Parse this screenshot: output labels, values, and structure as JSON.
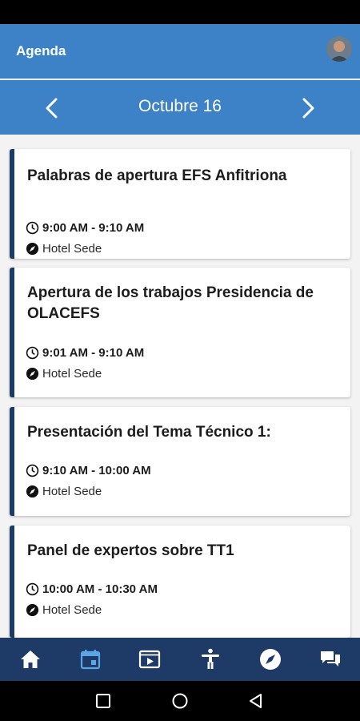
{
  "app_bar": {
    "title": "Agenda",
    "avatar_icon": "user-avatar"
  },
  "date_nav": {
    "date": "Octubre 16",
    "prev_icon": "chevron-left-icon",
    "next_icon": "chevron-right-icon"
  },
  "sessions": [
    {
      "title": "Palabras de apertura EFS Anfitriona",
      "time": "9:00 AM - 9:10 AM",
      "location": "Hotel Sede"
    },
    {
      "title": "Apertura de los trabajos Presidencia de OLACEFS",
      "time": "9:01 AM - 9:10 AM",
      "location": "Hotel Sede"
    },
    {
      "title": "Presentación del Tema Técnico 1:",
      "time": "9:10 AM - 10:00 AM",
      "location": "Hotel Sede"
    },
    {
      "title": "Panel de expertos sobre TT1",
      "time": "10:00 AM - 10:30 AM",
      "location": "Hotel Sede"
    }
  ],
  "bottom_nav": {
    "items": [
      "home-icon",
      "calendar-icon",
      "video-icon",
      "accessibility-icon",
      "compass-icon",
      "chat-icon"
    ],
    "active": "calendar-icon"
  },
  "colors": {
    "primary": "#3d82c6",
    "dark": "#1e3a66",
    "active_tab": "#5aa6e8"
  }
}
